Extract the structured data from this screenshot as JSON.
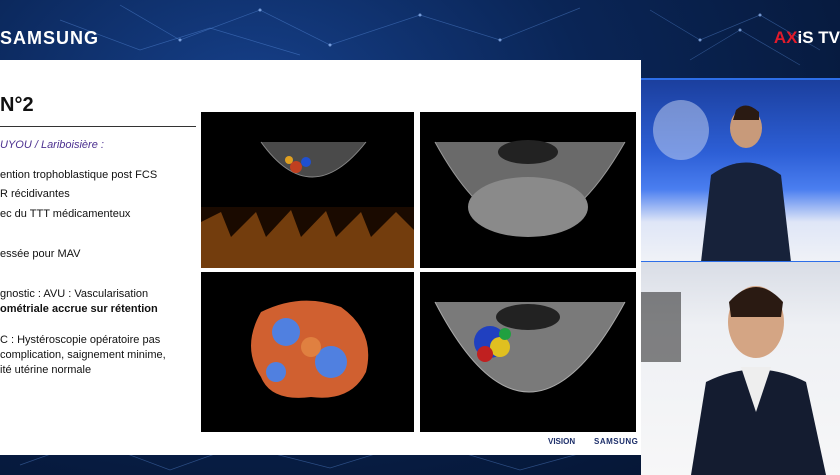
{
  "broadcast": {
    "left_logo": "SAMSUNG",
    "right_logo_ax": "AX",
    "right_logo_is": "iS",
    "right_logo_tv": " TV"
  },
  "slide": {
    "title": "N°2",
    "subtitle": "UYOU / Lariboisière :",
    "lines": [
      "ention trophoblastique post FCS",
      "R récidivantes",
      "ec du TTT médicamenteux",
      "essée pour MAV",
      "gnostic : AVU : Vascularisation",
      "ométriale accrue sur rétention",
      "C : Hystéroscopie opératoire pas",
      "complication, saignement minime,",
      "ité utérine normale"
    ],
    "footer_vision": "VISION",
    "footer_samsung": "SAMSUNG"
  },
  "colors": {
    "background": "#061a3c",
    "accent_blue": "#2d6ee8",
    "axis_red": "#e21b2b",
    "subtitle_purple": "#4b2f8f"
  }
}
